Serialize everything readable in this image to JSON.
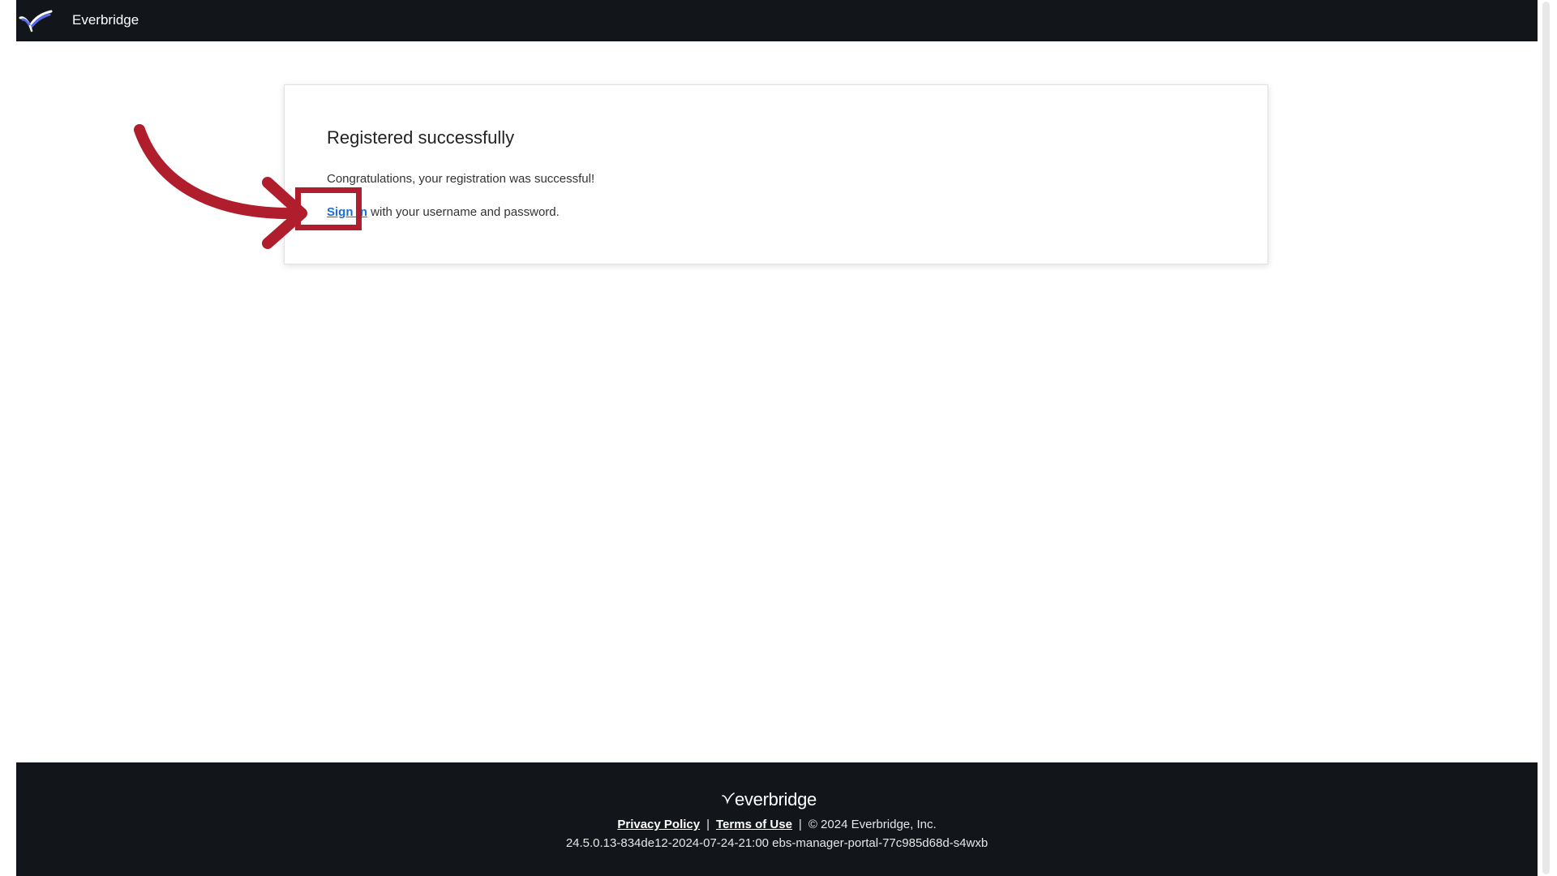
{
  "header": {
    "brand_name": "Everbridge"
  },
  "card": {
    "title": "Registered successfully",
    "message": "Congratulations, your registration was successful!",
    "signin_link": "Sign in",
    "signin_suffix": " with your username and password."
  },
  "footer": {
    "logo_text": "everbridge",
    "privacy_policy": "Privacy Policy",
    "separator": "|",
    "terms_of_use": "Terms of Use",
    "copyright": "©  2024 Everbridge, Inc.",
    "version": "24.5.0.13-834de12-2024-07-24-21:00 ebs-manager-portal-77c985d68d-s4wxb"
  },
  "annotation": {
    "color": "#b01e2e"
  },
  "colors": {
    "header_bg": "#12161b",
    "link": "#1a6fd0"
  }
}
